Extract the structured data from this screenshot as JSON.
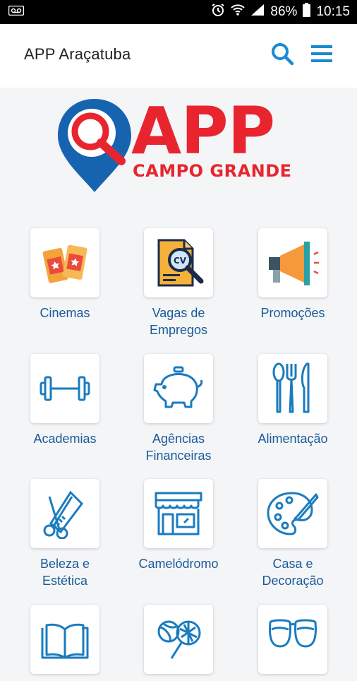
{
  "status_bar": {
    "battery": "86%",
    "time": "10:15"
  },
  "app_bar": {
    "title": "APP Araçatuba",
    "search_icon": "search-icon",
    "menu_icon": "menu-icon"
  },
  "logo": {
    "main": "APP",
    "sub": "CAMPO GRANDE",
    "colors": {
      "blue": "#1664b0",
      "red": "#e8252f"
    }
  },
  "categories": [
    {
      "label": "Cinemas",
      "icon": "cinema-tickets-icon"
    },
    {
      "label": "Vagas de\nEmpregos",
      "icon": "cv-search-icon"
    },
    {
      "label": "Promoções",
      "icon": "megaphone-icon"
    },
    {
      "label": "Academias",
      "icon": "dumbbell-icon"
    },
    {
      "label": "Agências\nFinanceiras",
      "icon": "piggy-bank-icon"
    },
    {
      "label": "Alimentação",
      "icon": "cutlery-icon"
    },
    {
      "label": "Beleza e\nEstética",
      "icon": "scissors-comb-icon"
    },
    {
      "label": "Camelódromo",
      "icon": "storefront-icon"
    },
    {
      "label": "Casa e\nDecoração",
      "icon": "paint-palette-icon"
    },
    {
      "label": "",
      "icon": "book-icon"
    },
    {
      "label": "",
      "icon": "sports-balls-icon"
    },
    {
      "label": "",
      "icon": "glasses-icon"
    }
  ],
  "colors": {
    "accent": "#1a8ad4",
    "label": "#1a5a99",
    "background": "#f4f5f7"
  }
}
